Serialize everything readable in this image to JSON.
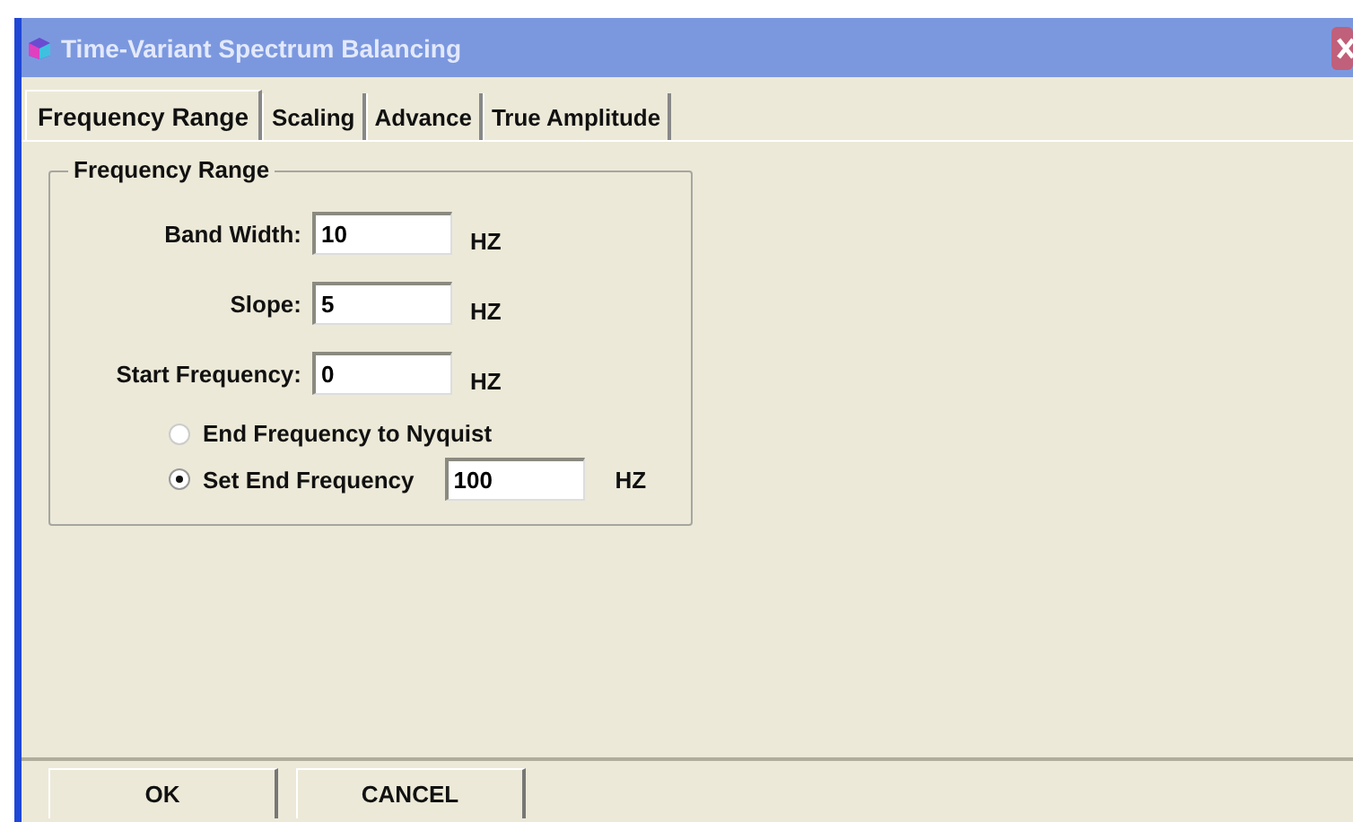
{
  "window": {
    "title": "Time-Variant Spectrum Balancing"
  },
  "tabs": [
    {
      "label": "Frequency Range",
      "selected": true
    },
    {
      "label": "Scaling",
      "selected": false
    },
    {
      "label": "Advance",
      "selected": false
    },
    {
      "label": "True Amplitude",
      "selected": false
    }
  ],
  "group": {
    "title": "Frequency Range",
    "fields": [
      {
        "label": "Band Width:",
        "value": "10",
        "unit": "HZ"
      },
      {
        "label": "Slope:",
        "value": "5",
        "unit": "HZ"
      },
      {
        "label": "Start Frequency:",
        "value": "0",
        "unit": "HZ"
      }
    ],
    "options": [
      {
        "label": "End Frequency to Nyquist",
        "selected": false
      },
      {
        "label": "Set End Frequency",
        "selected": true,
        "value": "100",
        "unit": "HZ"
      }
    ]
  },
  "buttons": [
    "OK",
    "CANCEL"
  ]
}
